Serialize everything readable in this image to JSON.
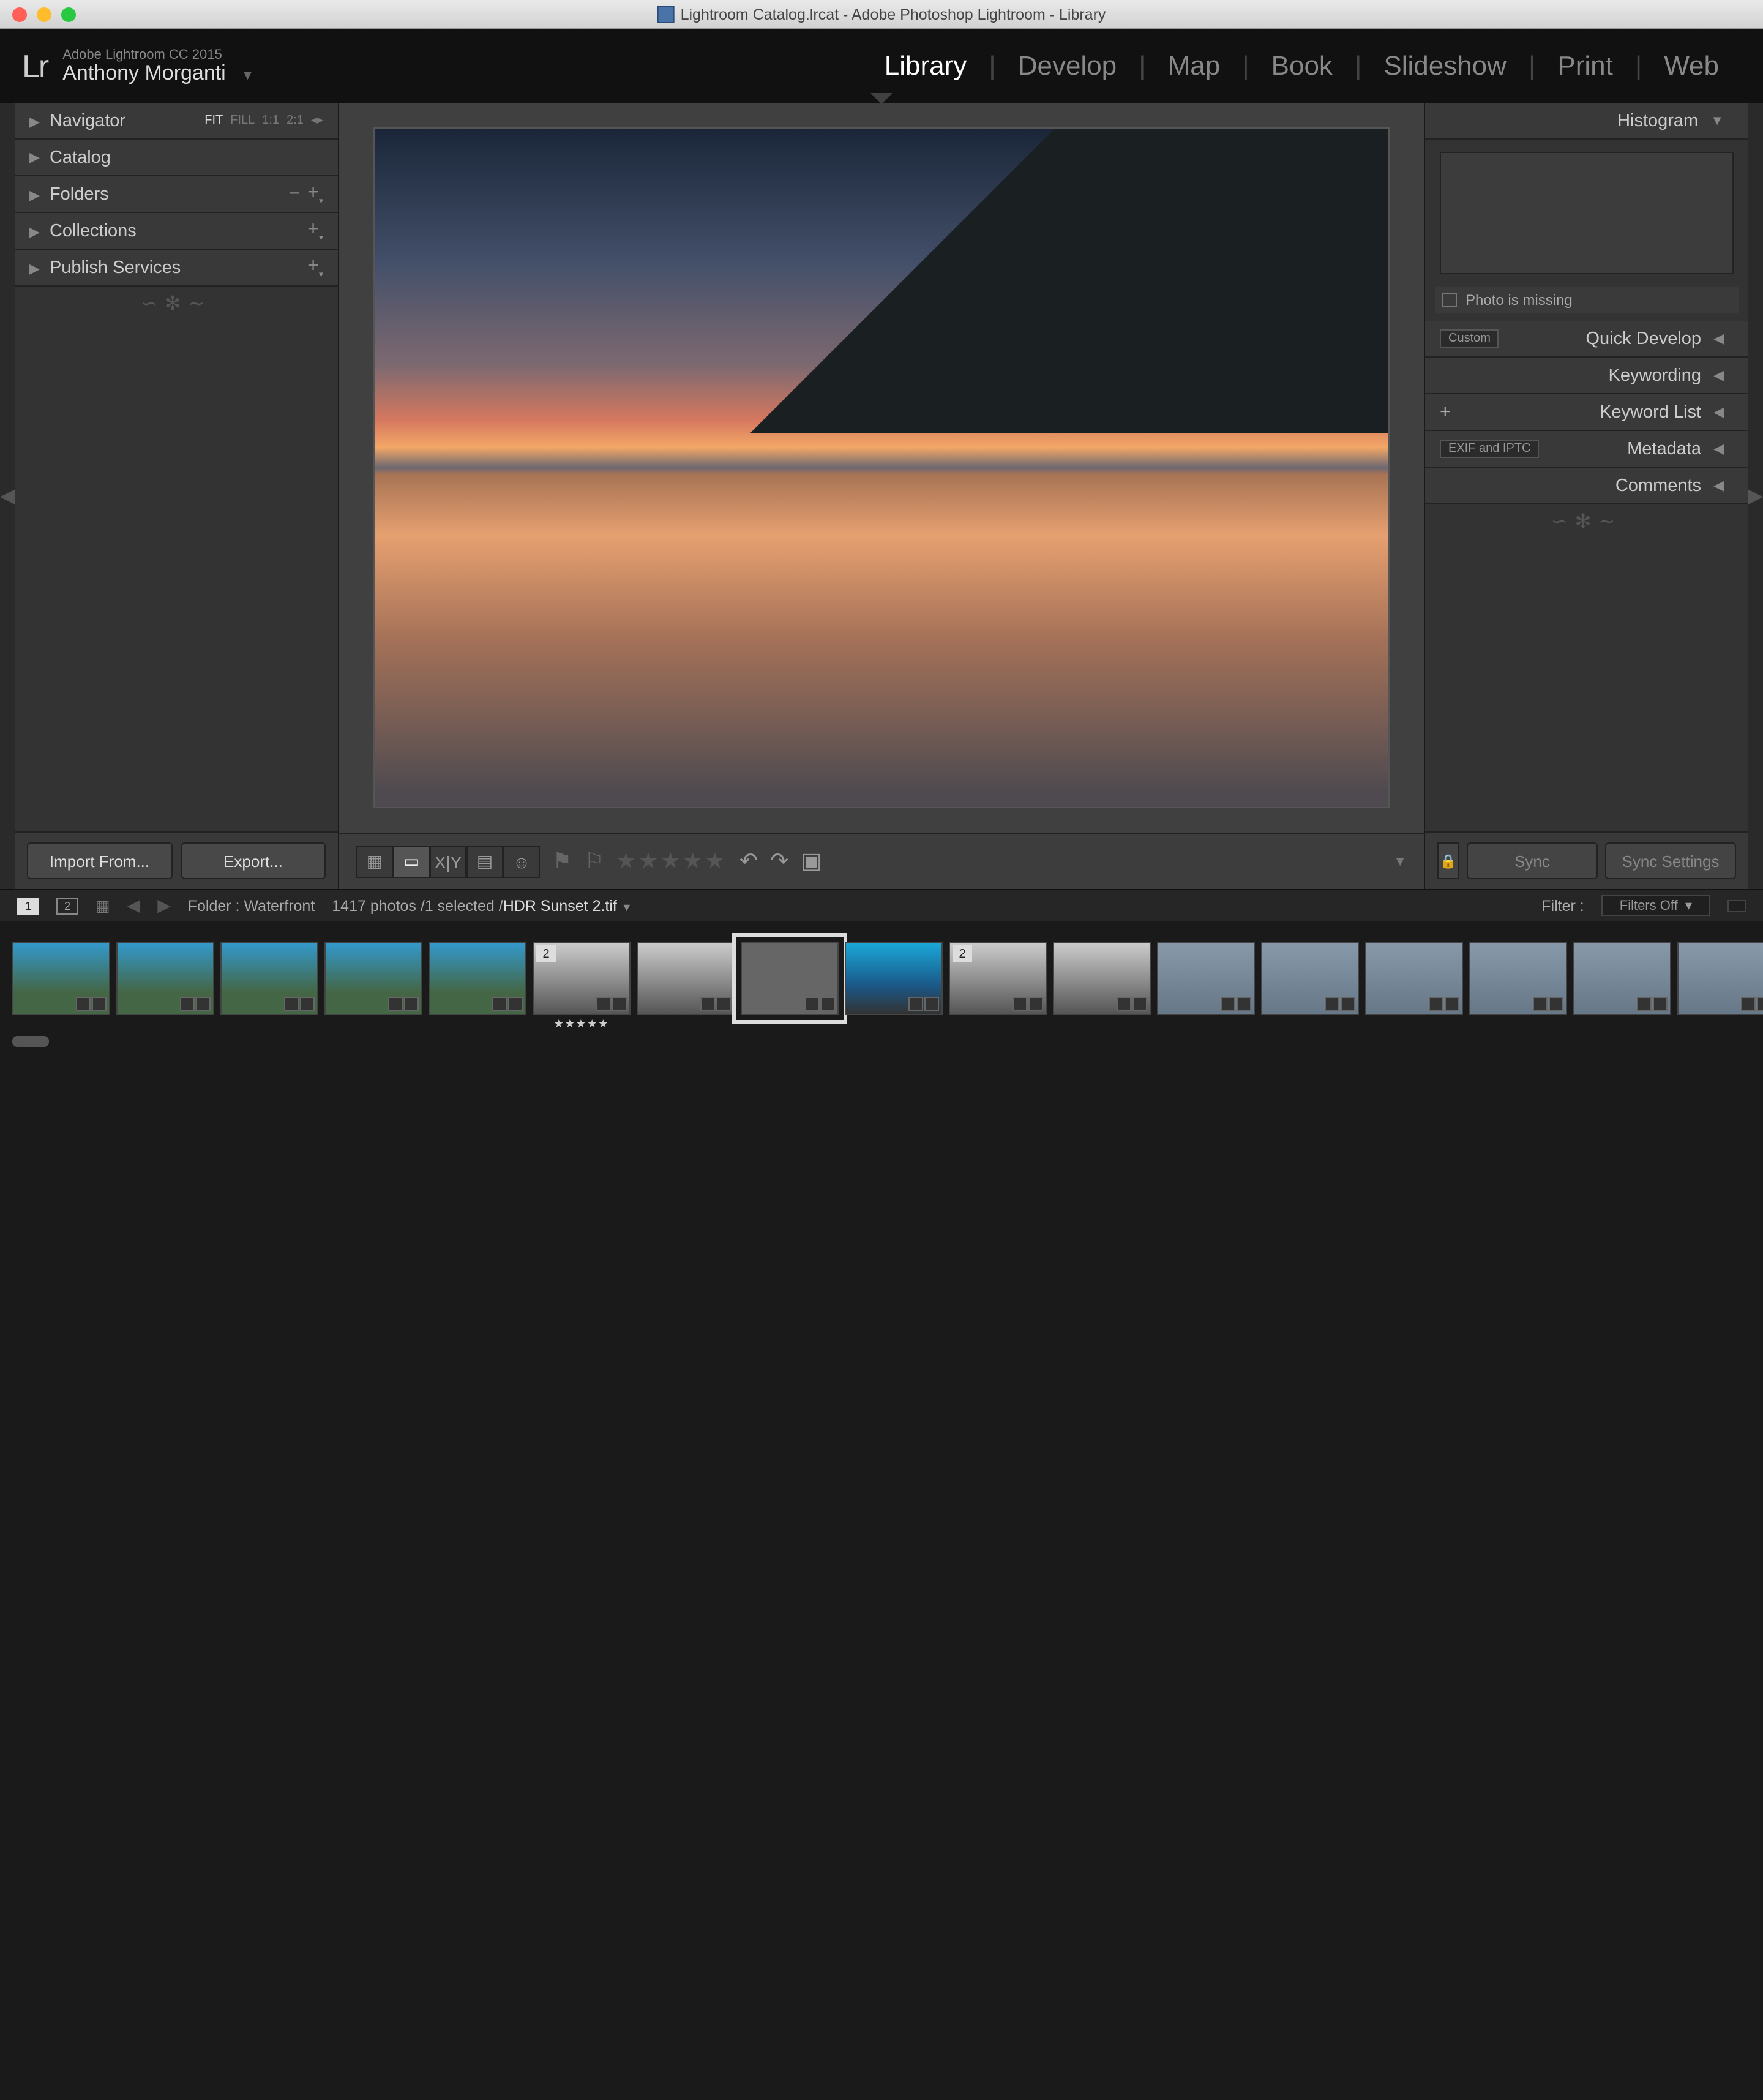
{
  "titlebar": "Lightroom Catalog.lrcat - Adobe Photoshop Lightroom - Library",
  "product": "Adobe Lightroom CC 2015",
  "user": "Anthony Morganti",
  "modules": [
    "Library",
    "Develop",
    "Map",
    "Book",
    "Slideshow",
    "Print",
    "Web"
  ],
  "active_module": "Library",
  "left": {
    "navigator": "Navigator",
    "nav_zoom": {
      "fit": "FIT",
      "fill": "FILL",
      "one": "1:1",
      "two": "2:1"
    },
    "catalog": "Catalog",
    "folders": "Folders",
    "collections": "Collections",
    "publish": "Publish Services",
    "import_btn": "Import From...",
    "export_btn": "Export..."
  },
  "right": {
    "histogram": "Histogram",
    "missing": "Photo is missing",
    "qd": "Quick Develop",
    "qd_preset": "Custom",
    "kw": "Keywording",
    "kwl": "Keyword List",
    "meta": "Metadata",
    "meta_preset": "EXIF and IPTC",
    "comments": "Comments",
    "sync": "Sync",
    "sync_settings": "Sync Settings"
  },
  "fs": {
    "folder_label": "Folder :",
    "folder_name": "Waterfront",
    "count": "1417 photos",
    "selected": "1 selected",
    "filename": "HDR Sunset 2.tif",
    "filter_label": "Filter :",
    "filter_value": "Filters Off"
  },
  "thumbs": [
    {
      "cls": "t-city"
    },
    {
      "cls": "t-city"
    },
    {
      "cls": "t-city"
    },
    {
      "cls": "t-city"
    },
    {
      "cls": "t-city"
    },
    {
      "cls": "t-bw",
      "stack": "2",
      "stars": true
    },
    {
      "cls": "t-bw"
    },
    {
      "cls": "t-sun",
      "sel": true
    },
    {
      "cls": "t-sky"
    },
    {
      "cls": "t-bw",
      "stack": "2"
    },
    {
      "cls": "t-bw"
    },
    {
      "cls": "t-gr"
    },
    {
      "cls": "t-gr"
    },
    {
      "cls": "t-gr"
    },
    {
      "cls": "t-gr"
    },
    {
      "cls": "t-gr"
    },
    {
      "cls": "t-gr"
    }
  ]
}
